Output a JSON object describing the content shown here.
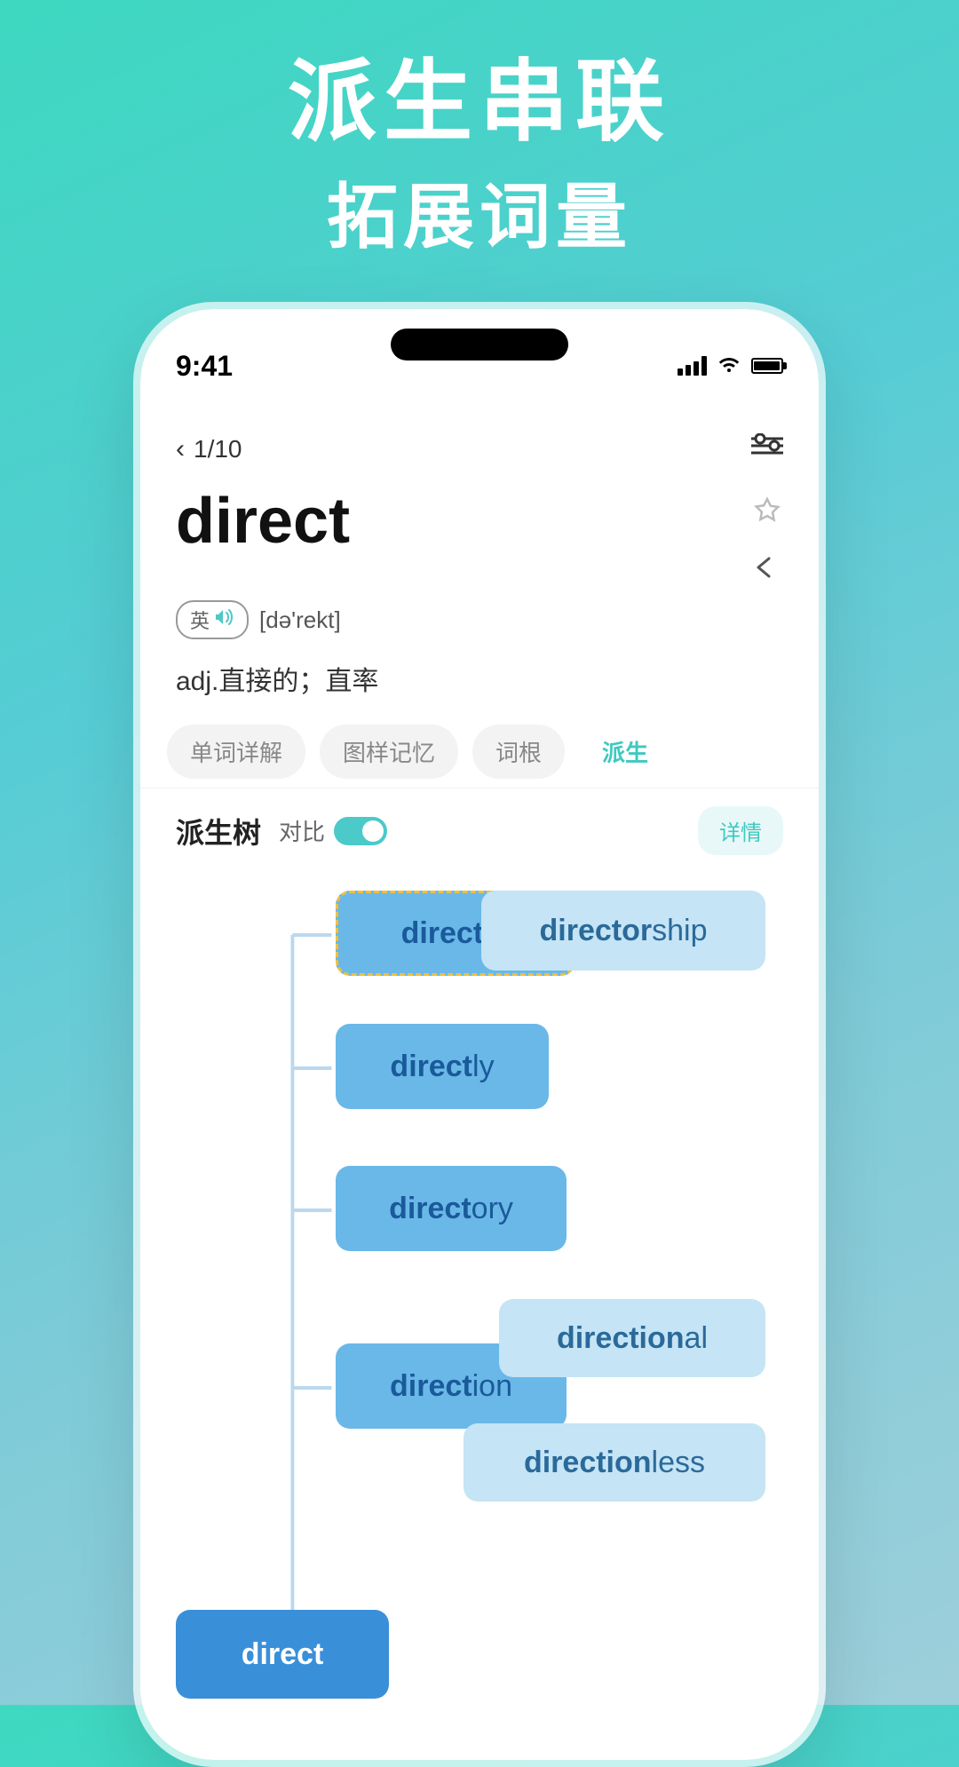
{
  "hero": {
    "line1": "派生串联",
    "line2": "拓展词量"
  },
  "phone": {
    "time": "9:41",
    "nav": {
      "page_indicator": "1/10",
      "back_label": "<",
      "filter_icon": "filter"
    },
    "word": {
      "title": "direct",
      "pronunciation_lang": "英",
      "phonetic": "[də'rekt]",
      "definition": "adj.直接的；直率"
    },
    "tabs": [
      {
        "label": "单词详解",
        "active": false
      },
      {
        "label": "图样记忆",
        "active": false
      },
      {
        "label": "词根",
        "active": false
      },
      {
        "label": "派生",
        "active": true
      }
    ],
    "paisheng": {
      "title": "派生树",
      "contrast_label": "对比",
      "detail_label": "详情"
    },
    "tree_nodes": [
      {
        "id": "root",
        "base": "direct",
        "suffix": "",
        "type": "root"
      },
      {
        "id": "director",
        "base": "direct",
        "suffix": "or",
        "type": "medium"
      },
      {
        "id": "directorship",
        "base": "director",
        "suffix": "ship",
        "type": "light"
      },
      {
        "id": "directly",
        "base": "direct",
        "suffix": "ly",
        "type": "medium"
      },
      {
        "id": "directory",
        "base": "direct",
        "suffix": "ory",
        "type": "medium"
      },
      {
        "id": "direction",
        "base": "direct",
        "suffix": "ion",
        "type": "medium"
      },
      {
        "id": "directional",
        "base": "direction",
        "suffix": "al",
        "type": "light"
      },
      {
        "id": "directionless",
        "base": "direction",
        "suffix": "less",
        "type": "light"
      }
    ]
  }
}
